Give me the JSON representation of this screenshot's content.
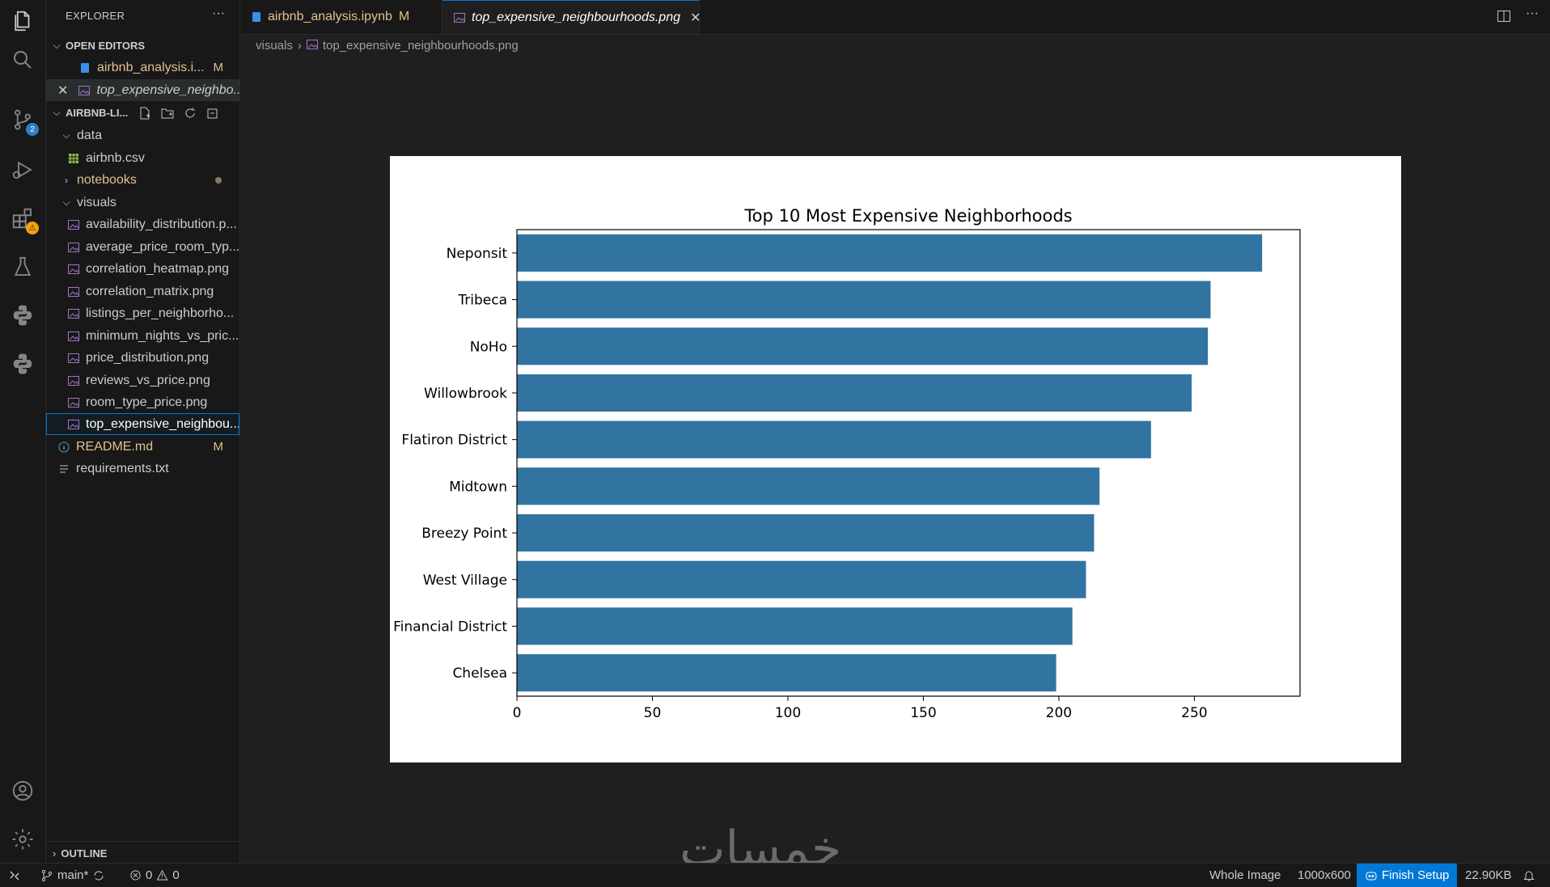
{
  "sidebar": {
    "title": "EXPLORER",
    "more": "···",
    "open_editors": {
      "header": "OPEN EDITORS",
      "items": [
        {
          "label": "airbnb_analysis.i...",
          "status": "M"
        },
        {
          "label": "top_expensive_neighbo..."
        }
      ]
    },
    "project": {
      "header": "AIRBNB-LI...",
      "tree": [
        {
          "label": "data"
        },
        {
          "label": "airbnb.csv"
        },
        {
          "label": "notebooks"
        },
        {
          "label": "visuals"
        },
        {
          "label": "availability_distribution.p..."
        },
        {
          "label": "average_price_room_typ..."
        },
        {
          "label": "correlation_heatmap.png"
        },
        {
          "label": "correlation_matrix.png"
        },
        {
          "label": "listings_per_neighborho..."
        },
        {
          "label": "minimum_nights_vs_pric..."
        },
        {
          "label": "price_distribution.png"
        },
        {
          "label": "reviews_vs_price.png"
        },
        {
          "label": "room_type_price.png"
        },
        {
          "label": "top_expensive_neighbou..."
        },
        {
          "label": "README.md",
          "status": "M"
        },
        {
          "label": "requirements.txt"
        }
      ]
    },
    "outline": "OUTLINE"
  },
  "activity_bar": {
    "icons": [
      "files-icon",
      "search-icon",
      "source-control-icon",
      "run-debug-icon",
      "extensions-icon",
      "testing-icon",
      "python-icon",
      "python-icon",
      "account-icon",
      "settings-icon"
    ],
    "scm_badge": "2",
    "extensions_badge": "⚠"
  },
  "tabs": [
    {
      "label": "airbnb_analysis.ipynb",
      "status": "M"
    },
    {
      "label": "top_expensive_neighbourhoods.png",
      "close": "✕"
    }
  ],
  "breadcrumb": {
    "folder": "visuals",
    "file": "top_expensive_neighbourhoods.png"
  },
  "chart_data": {
    "type": "bar",
    "orientation": "horizontal",
    "title": "Top 10 Most Expensive Neighborhoods",
    "categories": [
      "Neponsit",
      "Tribeca",
      "NoHo",
      "Willowbrook",
      "Flatiron District",
      "Midtown",
      "Breezy Point",
      "West Village",
      "Financial District",
      "Chelsea"
    ],
    "values": [
      275,
      256,
      255,
      249,
      234,
      215,
      213,
      210,
      205,
      199
    ],
    "xticks": [
      0,
      50,
      100,
      150,
      200,
      250
    ],
    "xlim": [
      0,
      289
    ],
    "bar_color": "#3274a1",
    "xlabel": "",
    "ylabel": ""
  },
  "watermark": "خمسات",
  "statusbar": {
    "remote_icon": "remote-icon",
    "branch": "main*",
    "errors": "0",
    "warnings": "0",
    "whole_image": "Whole Image",
    "dimensions": "1000x600",
    "finish_setup": "Finish Setup",
    "size": "22.90KB"
  }
}
